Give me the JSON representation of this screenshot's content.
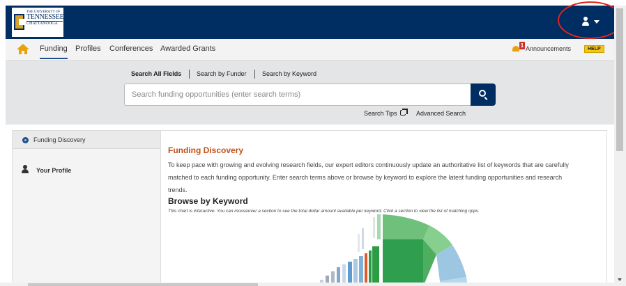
{
  "logo": {
    "line1": "THE UNIVERSITY OF",
    "line2": "TENNESSEE",
    "line3": "CHATTANOOGA"
  },
  "nav": {
    "items": [
      {
        "label": "Funding",
        "active": true
      },
      {
        "label": "Profiles",
        "active": false
      },
      {
        "label": "Conferences",
        "active": false
      },
      {
        "label": "Awarded Grants",
        "active": false
      }
    ],
    "announcements_count": "1",
    "announcements_label": "Announcements",
    "help_label": "HELP"
  },
  "search": {
    "tabs": [
      "Search All Fields",
      "Search by Funder",
      "Search by Keyword"
    ],
    "placeholder": "Search funding opportunities (enter search terms)",
    "tips_label": "Search Tips",
    "advanced_label": "Advanced Search"
  },
  "sidebar": {
    "items": [
      {
        "label": "Funding Discovery",
        "icon": "compass-icon"
      },
      {
        "label": "Your Profile",
        "icon": "user-icon"
      }
    ]
  },
  "main": {
    "heading": "Funding Discovery",
    "description": "To keep pace with growing and evolving research fields, our expert editors continuously update an authoritative list of keywords that are carefully matched to each funding opportunity. Enter search terms above or browse by keyword to explore the latest funding opportunities and research trends.",
    "browse_heading": "Browse by Keyword",
    "browse_note": "This chart is interactive. You can mouseover a section to see the total dollar amount available per keyword. Click a section to view the list of matching opps."
  },
  "colors": {
    "brand_navy": "#002d62",
    "accent_gold": "#e8a20c",
    "heading_orange": "#c0501a",
    "annotation_red": "#e0251f"
  }
}
